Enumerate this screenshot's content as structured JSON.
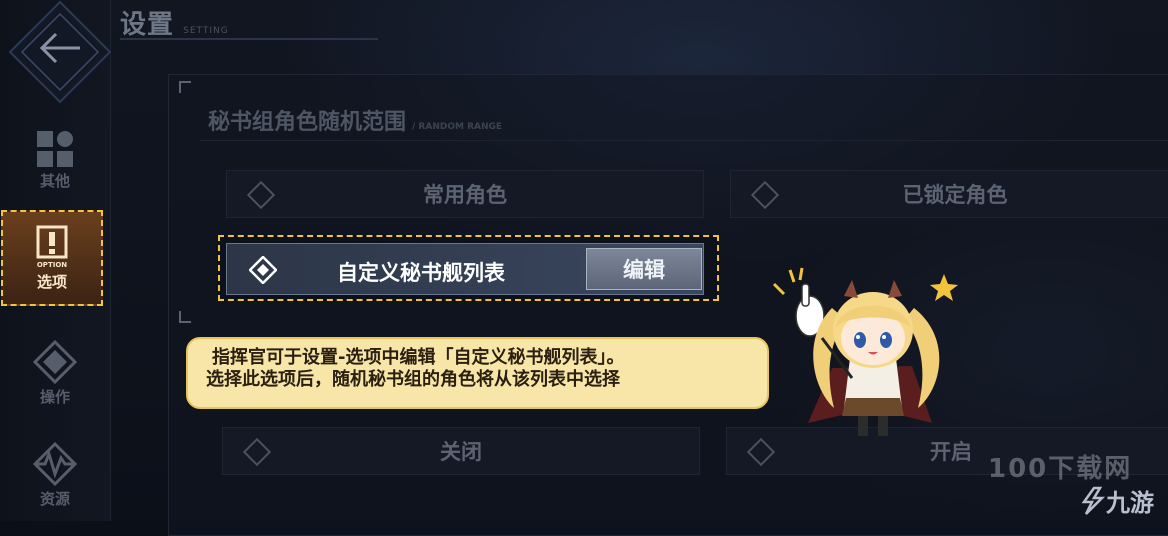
{
  "header": {
    "title": "设置",
    "subtitle": "SETTING"
  },
  "sidebar": {
    "items": [
      {
        "label": "其他",
        "icon": "grid-icon"
      },
      {
        "label": "选项",
        "icon": "option-icon",
        "icon_text": "OPTION",
        "active": true
      },
      {
        "label": "操作",
        "icon": "controls-icon"
      },
      {
        "label": "资源",
        "icon": "resource-icon"
      }
    ]
  },
  "section": {
    "title": "秘书组角色随机范围",
    "subtitle": "/ RANDOM RANGE",
    "options": {
      "common": "常用角色",
      "locked": "已锁定角色",
      "custom": "自定义秘书舰列表",
      "edit": "编辑"
    }
  },
  "section2": {
    "off": "关闭",
    "on": "开启"
  },
  "tooltip": {
    "line1": "指挥官可于设置-选项中编辑「自定义秘书舰列表」。",
    "line2": "选择此选项后，随机秘书组的角色将从该列表中选择"
  },
  "watermark": {
    "text": "九游",
    "faded": "100下载网"
  },
  "colors": {
    "highlight_dash": "#f2c43d",
    "tooltip_bg": "#f8e6a8",
    "active_tab_bg": "#6b3f1d"
  }
}
